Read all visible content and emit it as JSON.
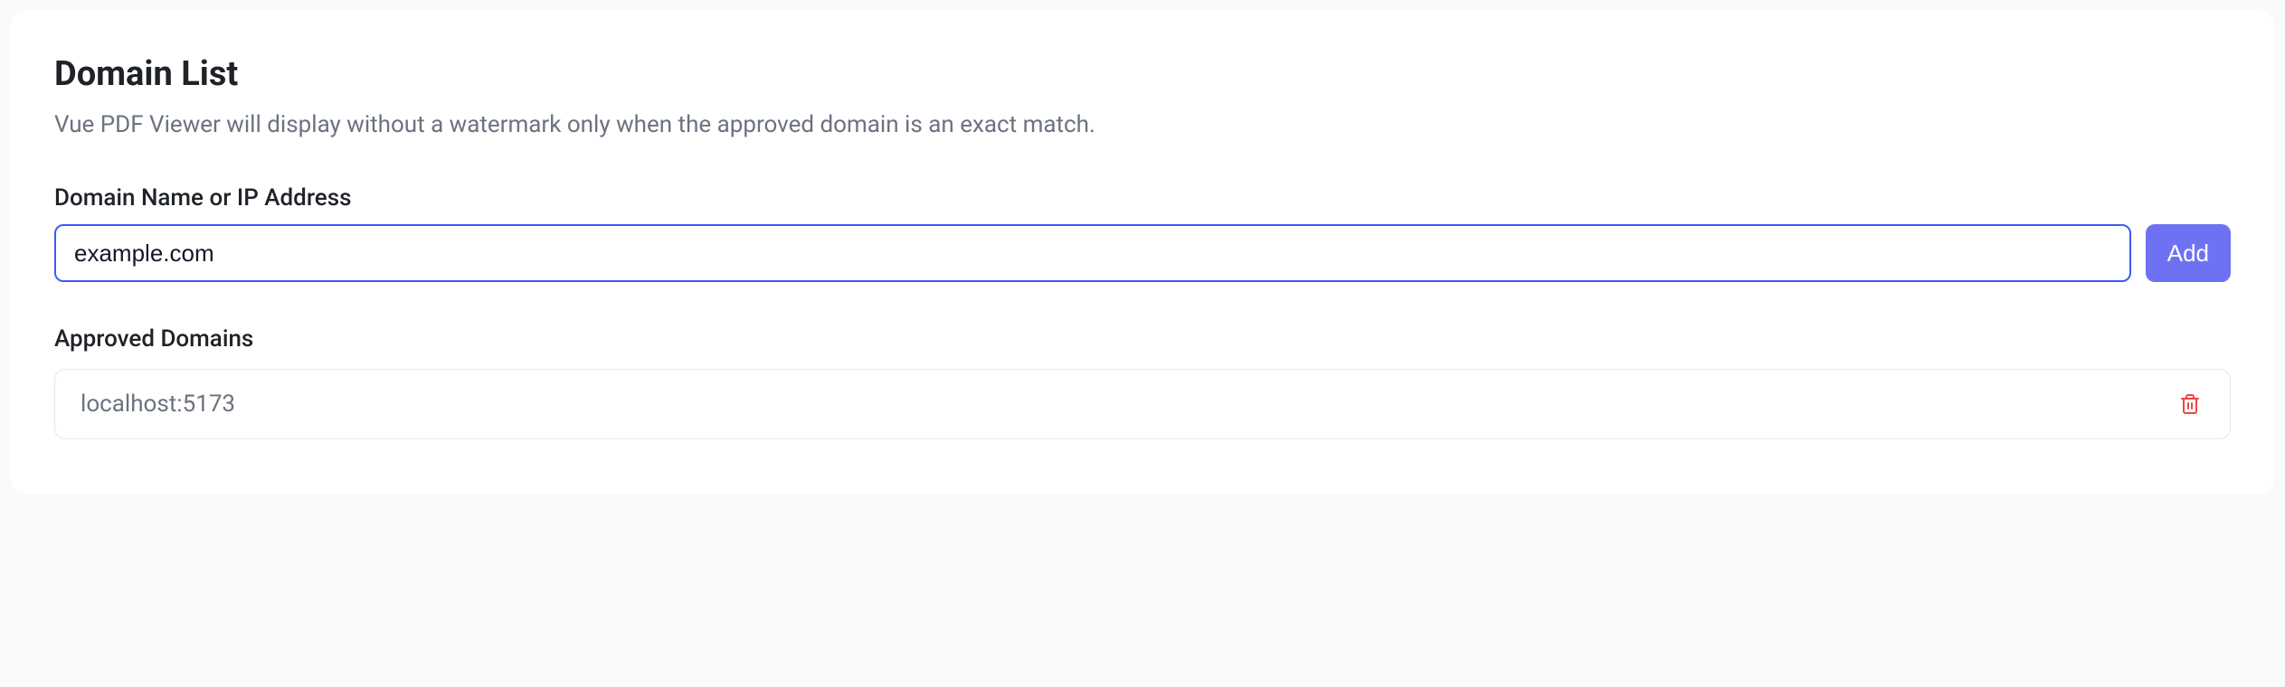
{
  "header": {
    "title": "Domain List",
    "subtitle": "Vue PDF Viewer will display without a watermark only when the approved domain is an exact match."
  },
  "form": {
    "input_label": "Domain Name or IP Address",
    "input_placeholder": "example.com",
    "add_button_label": "Add"
  },
  "approved": {
    "section_label": "Approved Domains",
    "domains": [
      {
        "value": "localhost:5173"
      }
    ]
  }
}
